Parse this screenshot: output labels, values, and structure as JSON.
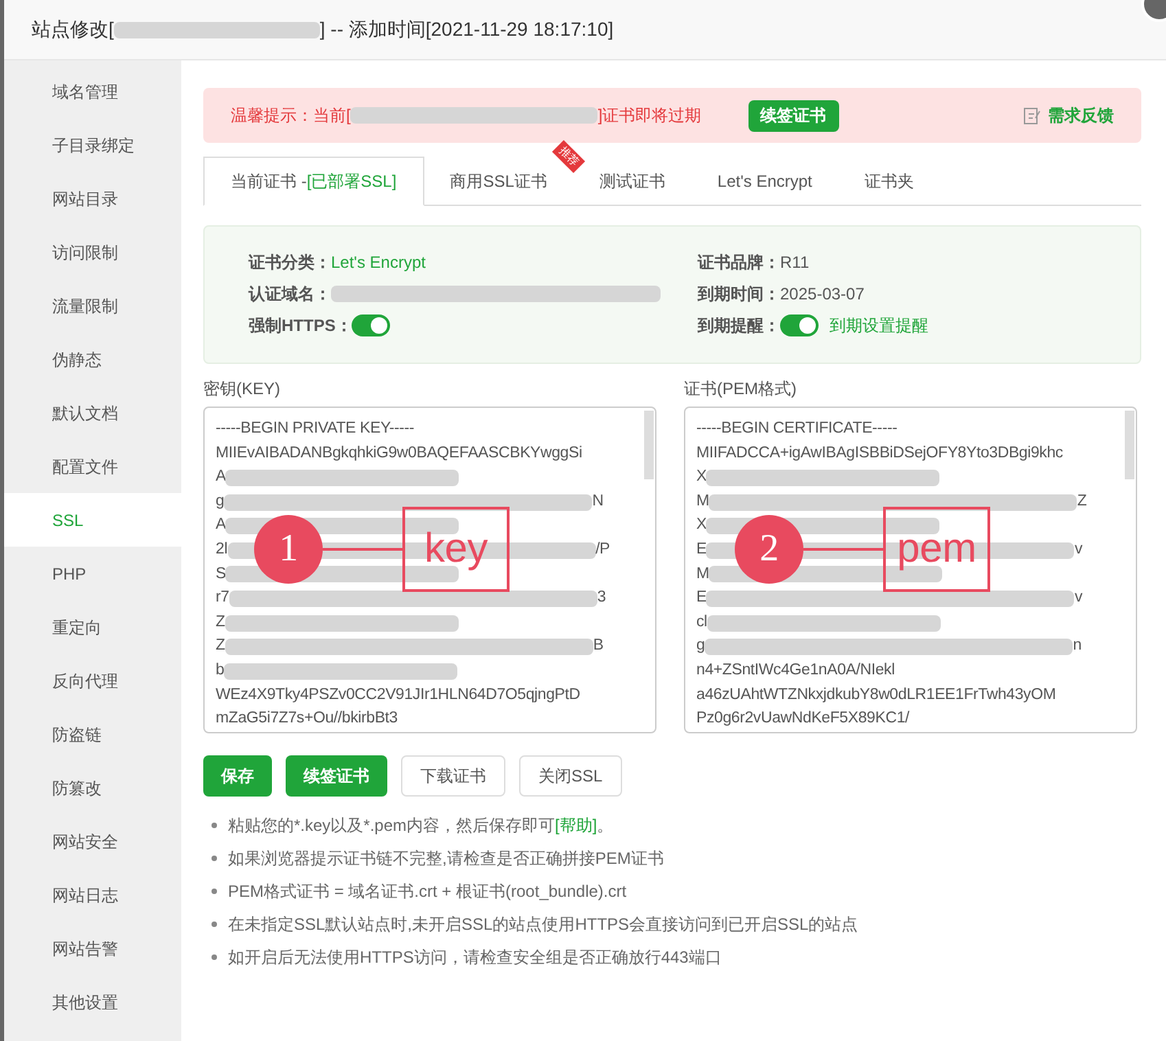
{
  "window": {
    "title_prefix": "站点修改[",
    "title_suffix": "] -- 添加时间[2021-11-29 18:17:10]"
  },
  "sidebar": {
    "items": [
      {
        "label": "域名管理",
        "selected": false
      },
      {
        "label": "子目录绑定",
        "selected": false
      },
      {
        "label": "网站目录",
        "selected": false
      },
      {
        "label": "访问限制",
        "selected": false
      },
      {
        "label": "流量限制",
        "selected": false
      },
      {
        "label": "伪静态",
        "selected": false
      },
      {
        "label": "默认文档",
        "selected": false
      },
      {
        "label": "配置文件",
        "selected": false
      },
      {
        "label": "SSL",
        "selected": true
      },
      {
        "label": "PHP",
        "selected": false
      },
      {
        "label": "重定向",
        "selected": false
      },
      {
        "label": "反向代理",
        "selected": false
      },
      {
        "label": "防盗链",
        "selected": false
      },
      {
        "label": "防篡改",
        "selected": false
      },
      {
        "label": "网站安全",
        "selected": false
      },
      {
        "label": "网站日志",
        "selected": false
      },
      {
        "label": "网站告警",
        "selected": false
      },
      {
        "label": "其他设置",
        "selected": false
      }
    ]
  },
  "alert": {
    "prefix": "温馨提示：当前[",
    "suffix": "]证书即将过期",
    "button": "续签证书",
    "feedback": "需求反馈"
  },
  "tabs": [
    {
      "label": "当前证书 - ",
      "status": "[已部署SSL]",
      "selected": true
    },
    {
      "label": "商用SSL证书",
      "ribbon": "推荐",
      "selected": false
    },
    {
      "label": "测试证书",
      "selected": false
    },
    {
      "label": "Let's Encrypt",
      "selected": false
    },
    {
      "label": "证书夹",
      "selected": false
    }
  ],
  "cert_info": {
    "left": [
      {
        "label": "证书分类：",
        "value": "Let's Encrypt",
        "kind": "green"
      },
      {
        "label": "认证域名：",
        "kind": "blurred"
      },
      {
        "label": "强制HTTPS：",
        "kind": "switch",
        "on": true
      }
    ],
    "right": [
      {
        "label": "证书品牌：",
        "value": "R11",
        "kind": "text"
      },
      {
        "label": "到期时间：",
        "value": "2025-03-07",
        "kind": "text"
      },
      {
        "label": "到期提醒：",
        "kind": "switch",
        "on": true,
        "link": "到期设置提醒"
      }
    ]
  },
  "editors": [
    {
      "label": "密钥(KEY)",
      "annotation": {
        "number": "1",
        "word": "key"
      },
      "lines": [
        {
          "text": "-----BEGIN PRIVATE KEY-----"
        },
        {
          "text": "MIIEvAIBADANBgkqhkiG9w0BAQEFAASCBKYwggSi"
        },
        {
          "text": "A",
          "blurred": true
        },
        {
          "text": "g",
          "blurred": true,
          "tail": "N"
        },
        {
          "text": "A",
          "blurred": true
        },
        {
          "text": "2l",
          "blurred": true,
          "tail": "/P"
        },
        {
          "text": "S",
          "blurred": true
        },
        {
          "text": "r7",
          "blurred": true,
          "tail": "3"
        },
        {
          "text": "Z",
          "blurred": true
        },
        {
          "text": "Z",
          "blurred": true,
          "tail": "B"
        },
        {
          "text": "b",
          "blurred": true
        },
        {
          "text": "WEz4X9Tky4PSZv0CC2V91JIr1HLN64D7O5qjngPtD"
        },
        {
          "text": "mZaG5i7Z7s+Ou//bkirbBt3"
        }
      ]
    },
    {
      "label": "证书(PEM格式)",
      "annotation": {
        "number": "2",
        "word": "pem"
      },
      "lines": [
        {
          "text": "-----BEGIN CERTIFICATE-----"
        },
        {
          "text": "MIIFADCCA+igAwIBAgISBBiDSejOFY8Yto3DBgi9khc"
        },
        {
          "text": "X",
          "blurred": true
        },
        {
          "text": "M",
          "blurred": true,
          "tail": "Z"
        },
        {
          "text": "X",
          "blurred": true
        },
        {
          "text": "E",
          "blurred": true,
          "tail": "v"
        },
        {
          "text": "M",
          "blurred": true
        },
        {
          "text": "E",
          "blurred": true,
          "tail": "v"
        },
        {
          "text": "cl",
          "blurred": true
        },
        {
          "text": "g",
          "blurred": true,
          "tail": "n"
        },
        {
          "text": "n4+ZSntIWc4Ge1nA0A/NIekl"
        },
        {
          "text": "a46zUAhtWTZNkxjdkubY8w0dLR1EE1FrTwh43yOM"
        },
        {
          "text": "Pz0g6r2vUawNdKeF5X89KC1/"
        }
      ]
    }
  ],
  "buttons": [
    {
      "label": "保存",
      "kind": "primary"
    },
    {
      "label": "续签证书",
      "kind": "primary"
    },
    {
      "label": "下载证书",
      "kind": "default"
    },
    {
      "label": "关闭SSL",
      "kind": "default"
    }
  ],
  "notes": [
    "粘贴您的*.key以及*.pem内容，然后保存即可",
    "如果浏览器提示证书链不完整,请检查是否正确拼接PEM证书",
    "PEM格式证书 = 域名证书.crt + 根证书(root_bundle).crt",
    "在未指定SSL默认站点时,未开启SSL的站点使用HTTPS会直接访问到已开启SSL的站点",
    "如开启后无法使用HTTPS访问，请检查安全组是否正确放行443端口"
  ],
  "help_link": "[帮助]",
  "help_end": "。"
}
